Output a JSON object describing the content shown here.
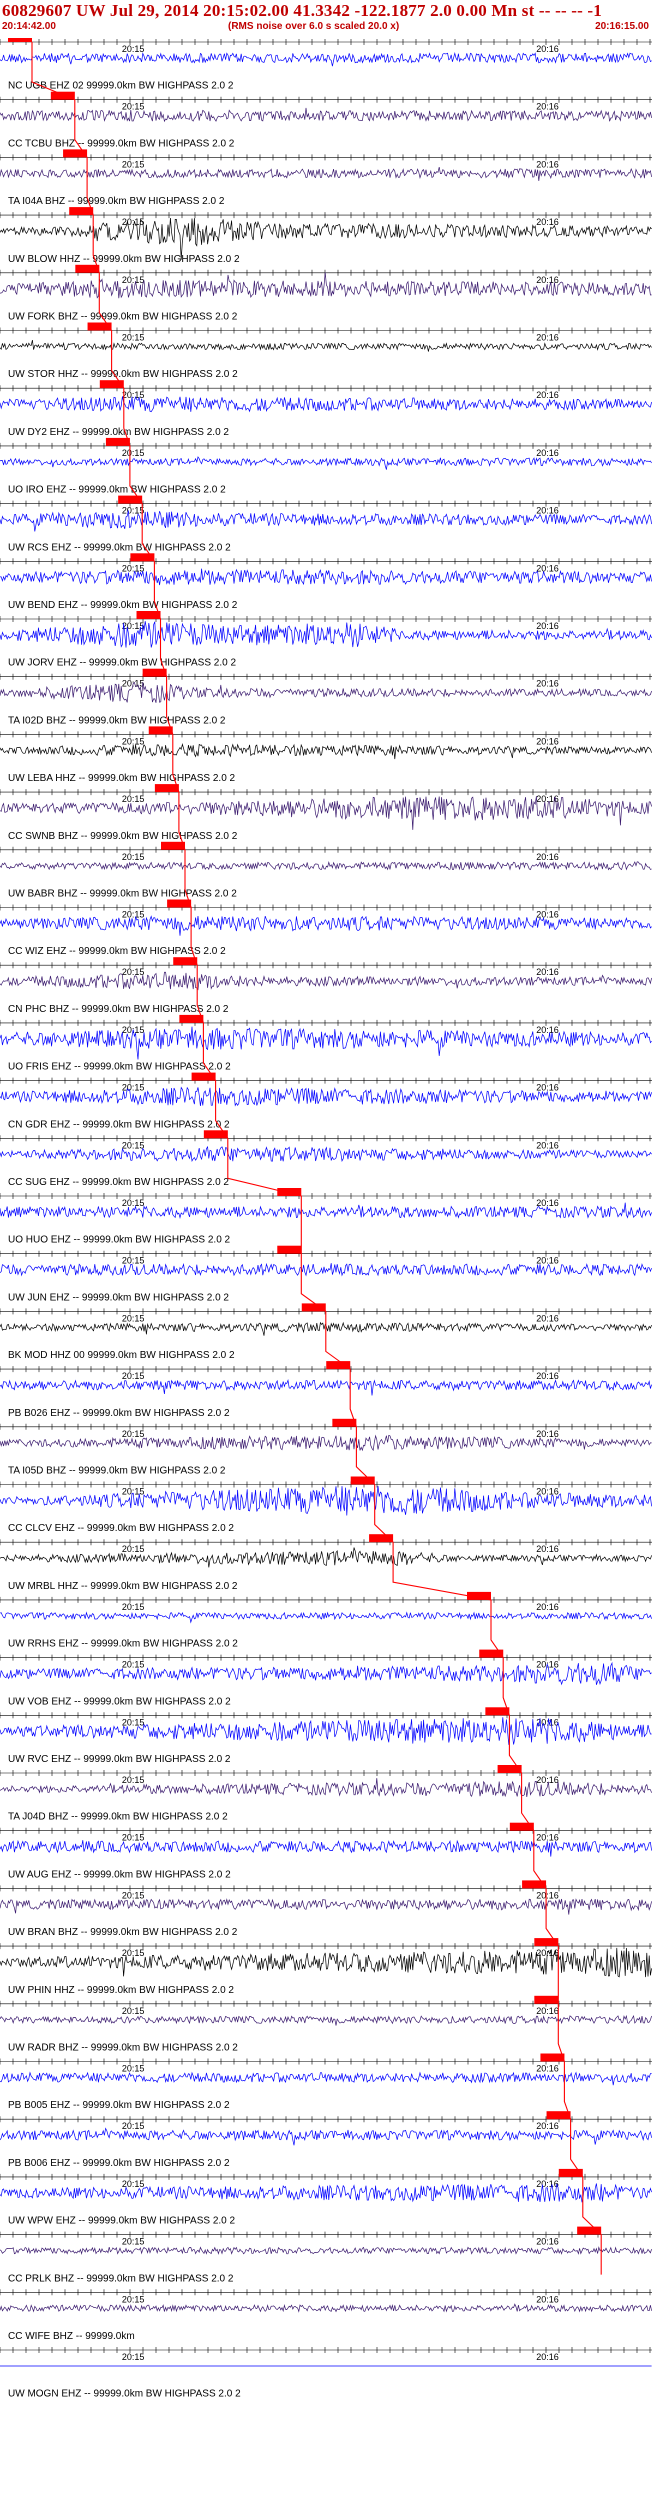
{
  "header": {
    "title": "60829607 UW Jul 29, 2014 20:15:02.00   41.3342 -122.1877  2.0 0.00 Mn st -- -- -- -1",
    "start_time": "20:14:42.00",
    "note": "(RMS noise over 6.0 s scaled 20.0 x)",
    "end_time": "20:16:15.00"
  },
  "time_labels": {
    "first": "20:15",
    "second": "20:16"
  },
  "colors": {
    "pick": "#ff0000",
    "label": "#000000",
    "blue": "#0000ff",
    "purple": "#3a1a6e",
    "black": "#000000",
    "background": "#ffffff"
  },
  "chart_data": {
    "type": "seismogram-record-section",
    "time_range": [
      "20:14:42.00",
      "20:16:15.00"
    ],
    "traces": [
      {
        "label": "NC UGB EHZ 02 99999.0km BW  HIGHPASS  2.0  2",
        "color": "blue",
        "pick_frac": 0.0,
        "env": [
          [
            0.0,
            0.3
          ],
          [
            1.0,
            0.3
          ]
        ]
      },
      {
        "label": "CC TCBU BHZ -- 99999.0km BW  HIGHPASS  2.0  2",
        "color": "purple",
        "pick_frac": 0.07,
        "env": [
          [
            0.0,
            0.3
          ],
          [
            0.15,
            0.35
          ],
          [
            1.0,
            0.3
          ]
        ]
      },
      {
        "label": "TA I04A BHZ -- 99999.0km BW  HIGHPASS  2.0  2",
        "color": "purple",
        "pick_frac": 0.09,
        "env": [
          [
            0.0,
            0.25
          ],
          [
            1.0,
            0.3
          ]
        ]
      },
      {
        "label": "UW BLOW HHZ -- 99999.0km BW  HIGHPASS  2.0  2",
        "color": "black",
        "pick_frac": 0.1,
        "env": [
          [
            0.0,
            0.2
          ],
          [
            0.12,
            0.35
          ],
          [
            0.28,
            1.0
          ],
          [
            0.42,
            0.5
          ],
          [
            1.0,
            0.3
          ]
        ]
      },
      {
        "label": "UW FORK BHZ -- 99999.0km BW  HIGHPASS  2.0  2",
        "color": "purple",
        "pick_frac": 0.11,
        "env": [
          [
            0.0,
            0.3
          ],
          [
            0.15,
            0.6
          ],
          [
            0.5,
            0.5
          ],
          [
            1.0,
            0.4
          ]
        ]
      },
      {
        "label": "UW STOR HHZ -- 99999.0km BW  HIGHPASS  2.0  2",
        "color": "black",
        "pick_frac": 0.13,
        "env": [
          [
            0.0,
            0.2
          ],
          [
            1.0,
            0.2
          ]
        ]
      },
      {
        "label": "UW DY2 EHZ -- 99999.0km BW  HIGHPASS  2.0  2",
        "color": "blue",
        "pick_frac": 0.15,
        "env": [
          [
            0.0,
            0.3
          ],
          [
            0.2,
            0.5
          ],
          [
            1.0,
            0.3
          ]
        ]
      },
      {
        "label": "UO IRO EHZ -- 99999.0km BW  HIGHPASS  2.0  2",
        "color": "blue",
        "pick_frac": 0.16,
        "env": [
          [
            0.0,
            0.2
          ],
          [
            1.0,
            0.25
          ]
        ]
      },
      {
        "label": "UW RCS EHZ -- 99999.0km BW  HIGHPASS  2.0  2",
        "color": "blue",
        "pick_frac": 0.18,
        "env": [
          [
            0.0,
            0.3
          ],
          [
            0.2,
            0.6
          ],
          [
            0.35,
            0.4
          ],
          [
            1.0,
            0.3
          ]
        ]
      },
      {
        "label": "UW BEND EHZ -- 99999.0km BW  HIGHPASS  2.0  2",
        "color": "blue",
        "pick_frac": 0.2,
        "env": [
          [
            0.0,
            0.3
          ],
          [
            0.25,
            0.5
          ],
          [
            1.0,
            0.35
          ]
        ]
      },
      {
        "label": "UW JORV EHZ -- 99999.0km BW  HIGHPASS  2.0  2",
        "color": "blue",
        "pick_frac": 0.21,
        "env": [
          [
            0.0,
            0.3
          ],
          [
            0.22,
            0.9
          ],
          [
            0.35,
            0.6
          ],
          [
            0.55,
            0.8
          ],
          [
            0.62,
            0.3
          ],
          [
            1.0,
            0.3
          ]
        ]
      },
      {
        "label": "TA I02D BHZ -- 99999.0km BW  HIGHPASS  2.0  2",
        "color": "purple",
        "pick_frac": 0.22,
        "env": [
          [
            0.0,
            0.2
          ],
          [
            0.23,
            0.7
          ],
          [
            0.3,
            0.3
          ],
          [
            1.0,
            0.2
          ]
        ]
      },
      {
        "label": "UW LEBA HHZ -- 99999.0km BW  HIGHPASS  2.0  2",
        "color": "black",
        "pick_frac": 0.23,
        "env": [
          [
            0.0,
            0.2
          ],
          [
            0.25,
            0.4
          ],
          [
            1.0,
            0.2
          ]
        ]
      },
      {
        "label": "CC SWNB BHZ -- 99999.0km BW  HIGHPASS  2.0  2",
        "color": "purple",
        "pick_frac": 0.24,
        "env": [
          [
            0.0,
            0.3
          ],
          [
            0.3,
            0.4
          ],
          [
            0.55,
            0.7
          ],
          [
            0.8,
            0.8
          ],
          [
            1.0,
            0.4
          ]
        ]
      },
      {
        "label": "UW BABR BHZ -- 99999.0km BW  HIGHPASS  2.0  2",
        "color": "purple",
        "pick_frac": 0.25,
        "env": [
          [
            0.0,
            0.2
          ],
          [
            1.0,
            0.25
          ]
        ]
      },
      {
        "label": "CC WIZ EHZ -- 99999.0km BW  HIGHPASS  2.0  2",
        "color": "blue",
        "pick_frac": 0.26,
        "env": [
          [
            0.0,
            0.3
          ],
          [
            0.3,
            0.5
          ],
          [
            1.0,
            0.35
          ]
        ]
      },
      {
        "label": "CN PHC BHZ -- 99999.0km BW  HIGHPASS  2.0  2",
        "color": "purple",
        "pick_frac": 0.27,
        "env": [
          [
            0.0,
            0.25
          ],
          [
            0.28,
            0.6
          ],
          [
            0.4,
            0.3
          ],
          [
            1.0,
            0.25
          ]
        ]
      },
      {
        "label": "UO FRIS EHZ -- 99999.0km BW  HIGHPASS  2.0  2",
        "color": "blue",
        "pick_frac": 0.28,
        "env": [
          [
            0.0,
            0.4
          ],
          [
            0.3,
            0.7
          ],
          [
            1.0,
            0.4
          ]
        ]
      },
      {
        "label": "CN GDR EHZ -- 99999.0km BW  HIGHPASS  2.0  2",
        "color": "blue",
        "pick_frac": 0.3,
        "env": [
          [
            0.0,
            0.3
          ],
          [
            0.3,
            0.6
          ],
          [
            1.0,
            0.3
          ]
        ]
      },
      {
        "label": "CC SUG EHZ -- 99999.0km BW  HIGHPASS  2.0  2",
        "color": "blue",
        "pick_frac": 0.32,
        "env": [
          [
            0.0,
            0.2
          ],
          [
            0.34,
            0.5
          ],
          [
            1.0,
            0.2
          ]
        ]
      },
      {
        "label": "UO HUO EHZ -- 99999.0km BW  HIGHPASS  2.0  2",
        "color": "blue",
        "pick_frac": 0.44,
        "env": [
          [
            0.0,
            0.35
          ],
          [
            1.0,
            0.35
          ]
        ]
      },
      {
        "label": "UW JUN EHZ -- 99999.0km BW  HIGHPASS  2.0  2",
        "color": "blue",
        "pick_frac": 0.44,
        "env": [
          [
            0.0,
            0.35
          ],
          [
            1.0,
            0.35
          ]
        ]
      },
      {
        "label": "BK MOD HHZ 00 99999.0km BW  HIGHPASS  2.0  2",
        "color": "black",
        "pick_frac": 0.48,
        "env": [
          [
            0.0,
            0.2
          ],
          [
            0.5,
            0.3
          ],
          [
            1.0,
            0.2
          ]
        ]
      },
      {
        "label": "PB B026 EHZ -- 99999.0km BW  HIGHPASS  2.0  2",
        "color": "blue",
        "pick_frac": 0.52,
        "env": [
          [
            0.0,
            0.3
          ],
          [
            1.0,
            0.3
          ]
        ]
      },
      {
        "label": "TA I05D BHZ -- 99999.0km BW  HIGHPASS  2.0  2",
        "color": "purple",
        "pick_frac": 0.53,
        "env": [
          [
            0.0,
            0.2
          ],
          [
            0.54,
            0.5
          ],
          [
            1.0,
            0.2
          ]
        ]
      },
      {
        "label": "CC CLCV EHZ -- 99999.0km BW  HIGHPASS  2.0  2",
        "color": "blue",
        "pick_frac": 0.56,
        "env": [
          [
            0.0,
            0.2
          ],
          [
            0.57,
            1.0
          ],
          [
            0.7,
            0.8
          ],
          [
            0.8,
            0.5
          ],
          [
            1.0,
            0.4
          ]
        ]
      },
      {
        "label": "UW MRBL HHZ -- 99999.0km BW  HIGHPASS  2.0  2",
        "color": "black",
        "pick_frac": 0.59,
        "env": [
          [
            0.0,
            0.2
          ],
          [
            0.6,
            0.5
          ],
          [
            0.7,
            0.2
          ],
          [
            1.0,
            0.2
          ]
        ]
      },
      {
        "label": "UW RRHS EHZ -- 99999.0km BW  HIGHPASS  2.0  2",
        "color": "blue",
        "pick_frac": 0.75,
        "env": [
          [
            0.0,
            0.2
          ],
          [
            1.0,
            0.2
          ]
        ]
      },
      {
        "label": "UW VOB EHZ -- 99999.0km BW  HIGHPASS  2.0  2",
        "color": "blue",
        "pick_frac": 0.77,
        "env": [
          [
            0.0,
            0.3
          ],
          [
            0.78,
            0.5
          ],
          [
            0.92,
            0.8
          ],
          [
            1.0,
            0.3
          ]
        ]
      },
      {
        "label": "UW RVC EHZ -- 99999.0km BW  HIGHPASS  2.0  2",
        "color": "blue",
        "pick_frac": 0.78,
        "env": [
          [
            0.0,
            0.3
          ],
          [
            0.8,
            0.9
          ],
          [
            0.92,
            0.6
          ],
          [
            1.0,
            0.4
          ]
        ]
      },
      {
        "label": "TA J04D BHZ -- 99999.0km BW  HIGHPASS  2.0  2",
        "color": "purple",
        "pick_frac": 0.8,
        "env": [
          [
            0.0,
            0.2
          ],
          [
            0.82,
            0.5
          ],
          [
            1.0,
            0.3
          ]
        ]
      },
      {
        "label": "UW AUG EHZ -- 99999.0km BW  HIGHPASS  2.0  2",
        "color": "blue",
        "pick_frac": 0.82,
        "env": [
          [
            0.0,
            0.35
          ],
          [
            1.0,
            0.35
          ]
        ]
      },
      {
        "label": "UW BRAN BHZ -- 99999.0km BW  HIGHPASS  2.0  2",
        "color": "purple",
        "pick_frac": 0.84,
        "env": [
          [
            0.0,
            0.3
          ],
          [
            1.0,
            0.35
          ]
        ]
      },
      {
        "label": "UW PHIN HHZ -- 99999.0km BW  HIGHPASS  2.0  2",
        "color": "black",
        "pick_frac": 0.86,
        "env": [
          [
            0.0,
            0.3
          ],
          [
            0.87,
            0.8
          ],
          [
            1.0,
            1.0
          ]
        ]
      },
      {
        "label": "UW RADR BHZ -- 99999.0km BW  HIGHPASS  2.0  2",
        "color": "purple",
        "pick_frac": 0.86,
        "env": [
          [
            0.0,
            0.2
          ],
          [
            1.0,
            0.25
          ]
        ]
      },
      {
        "label": "PB B005 EHZ -- 99999.0km BW  HIGHPASS  2.0  2",
        "color": "blue",
        "pick_frac": 0.87,
        "env": [
          [
            0.0,
            0.3
          ],
          [
            1.0,
            0.3
          ]
        ]
      },
      {
        "label": "PB B006 EHZ -- 99999.0km BW  HIGHPASS  2.0  2",
        "color": "blue",
        "pick_frac": 0.88,
        "env": [
          [
            0.0,
            0.3
          ],
          [
            1.0,
            0.3
          ]
        ]
      },
      {
        "label": "UW WPW EHZ -- 99999.0km BW  HIGHPASS  2.0  2",
        "color": "blue",
        "pick_frac": 0.9,
        "env": [
          [
            0.0,
            0.3
          ],
          [
            0.92,
            0.6
          ],
          [
            1.0,
            0.3
          ]
        ]
      },
      {
        "label": "CC PRLK BHZ -- 99999.0km BW  HIGHPASS  2.0  2",
        "color": "purple",
        "pick_frac": 0.93,
        "env": [
          [
            0.0,
            0.2
          ],
          [
            1.0,
            0.2
          ]
        ]
      },
      {
        "label": "CC WIFE BHZ -- 99999.0km",
        "color": "purple",
        "pick_frac": null,
        "env": [
          [
            0.0,
            0.2
          ],
          [
            1.0,
            0.2
          ]
        ]
      },
      {
        "label": "UW MOGN EHZ -- 99999.0km BW  HIGHPASS  2.0  2",
        "color": "blue",
        "pick_frac": null,
        "env": [
          [
            0.0,
            0.0
          ],
          [
            1.0,
            0.0
          ]
        ]
      }
    ]
  }
}
